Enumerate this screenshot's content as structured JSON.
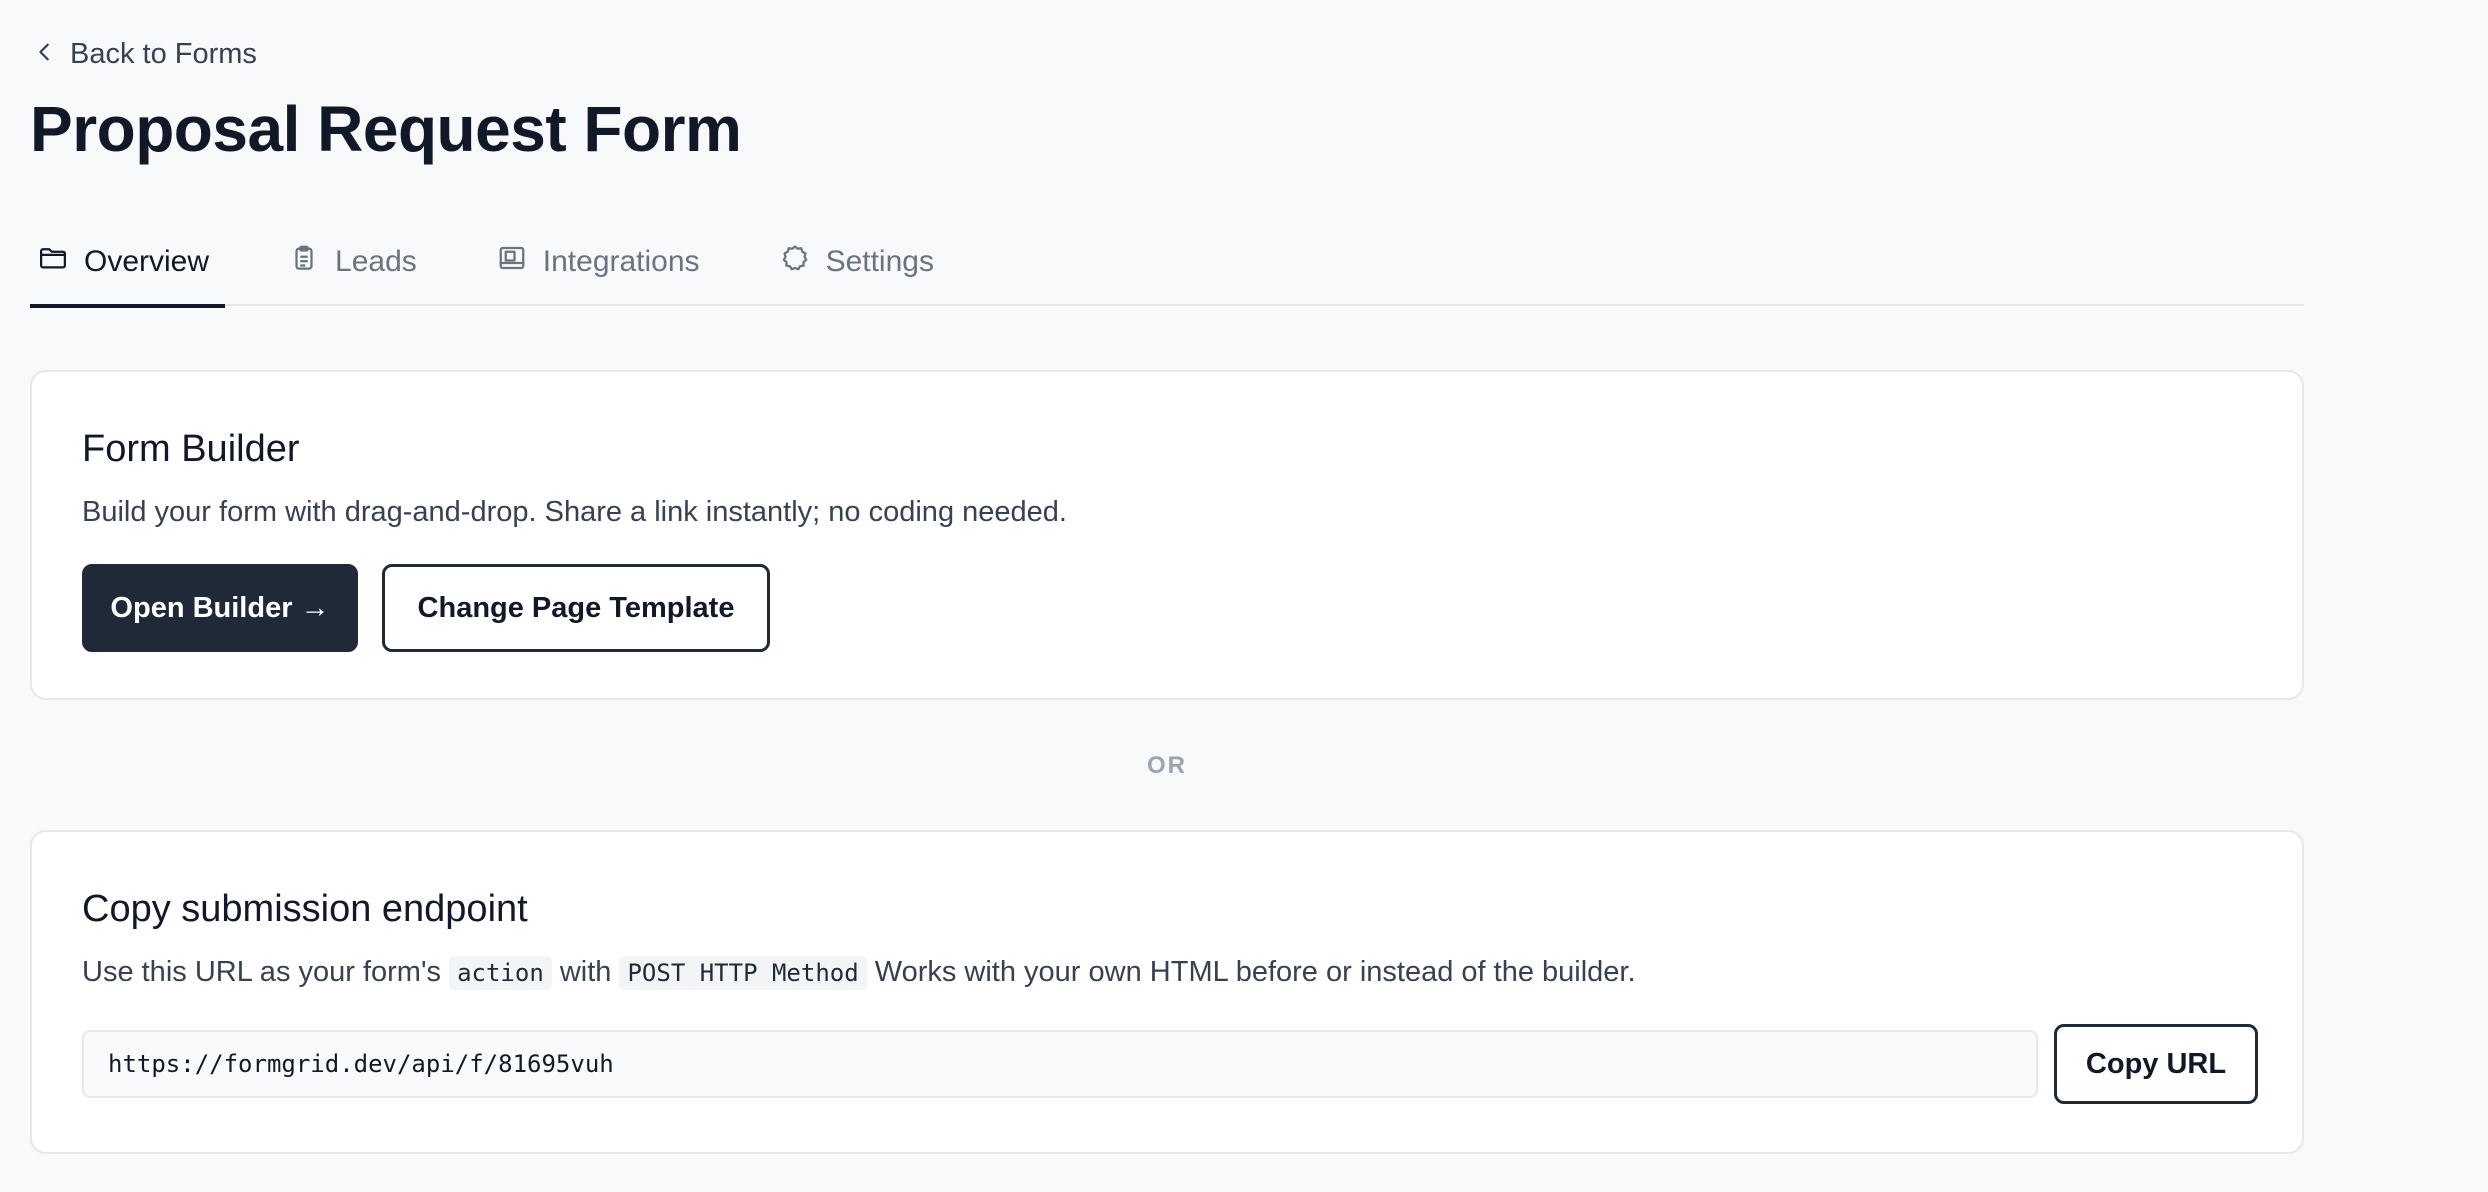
{
  "back_link": {
    "label": "Back to Forms",
    "icon": "chevron-left-icon"
  },
  "page_title": "Proposal Request Form",
  "tabs": [
    {
      "label": "Overview",
      "icon": "folder-icon",
      "active": true
    },
    {
      "label": "Leads",
      "icon": "clipboard-icon",
      "active": false
    },
    {
      "label": "Integrations",
      "icon": "layout-icon",
      "active": false
    },
    {
      "label": "Settings",
      "icon": "gear-icon",
      "active": false
    }
  ],
  "form_builder": {
    "title": "Form Builder",
    "description": "Build your form with drag-and-drop. Share a link instantly; no coding needed.",
    "open_builder_label": "Open Builder →",
    "change_template_label": "Change Page Template"
  },
  "divider_label": "OR",
  "endpoint": {
    "title": "Copy submission endpoint",
    "desc_part1": "Use this URL as your form's",
    "code_action": "action",
    "desc_part2": "with",
    "code_method": "POST HTTP Method",
    "desc_part3": "Works with your own HTML before or instead of the builder.",
    "url_value": "https://formgrid.dev/api/f/81695vuh",
    "copy_label": "Copy URL"
  },
  "colors": {
    "background": "#f8f9fb",
    "primary_button": "#1f2937",
    "text_primary": "#111827",
    "text_muted": "#6b7280",
    "border": "#e5e7eb"
  }
}
